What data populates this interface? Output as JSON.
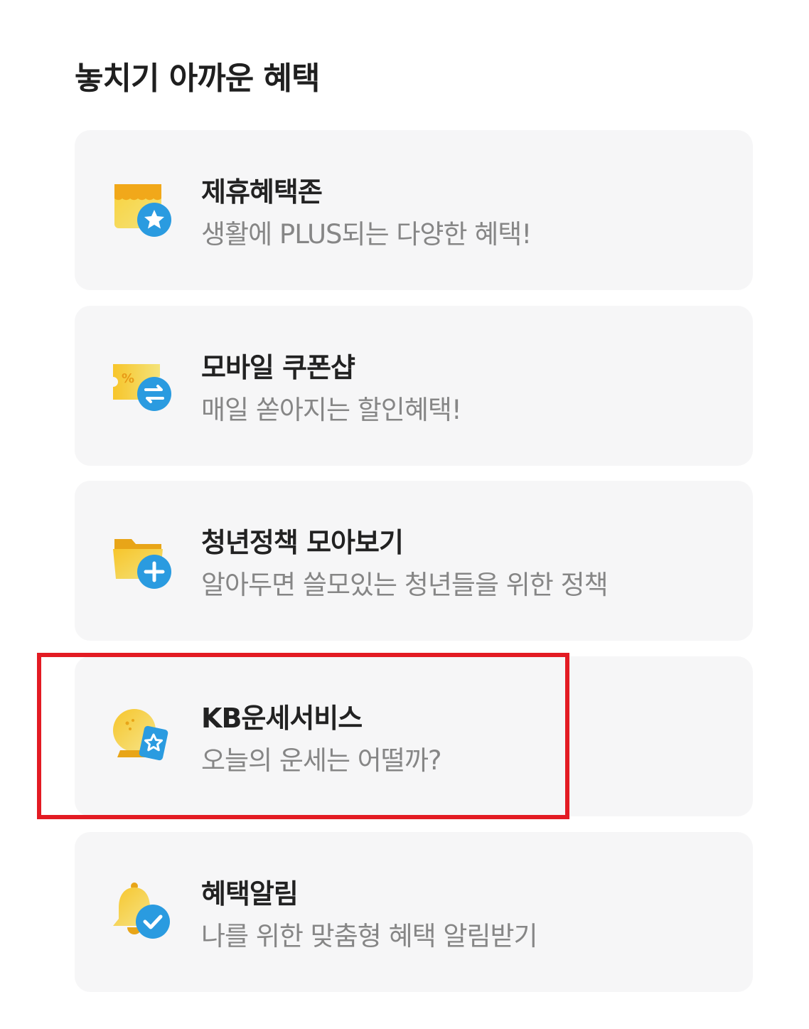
{
  "section": {
    "title": "놓치기 아까운 혜택"
  },
  "cards": [
    {
      "title": "제휴혜택존",
      "desc": "생활에 PLUS되는 다양한 혜택!",
      "icon": "store-star-icon"
    },
    {
      "title": "모바일 쿠폰샵",
      "desc": "매일 쏟아지는 할인혜택!",
      "icon": "coupon-exchange-icon"
    },
    {
      "title": "청년정책 모아보기",
      "desc": "알아두면 쓸모있는 청년들을 위한 정책",
      "icon": "folder-plus-icon"
    },
    {
      "title": "KB운세서비스",
      "desc": "오늘의 운세는 어떨까?",
      "icon": "crystal-ball-card-icon"
    },
    {
      "title": "혜택알림",
      "desc": "나를 위한 맞춤형 혜택 알림받기",
      "icon": "bell-check-icon"
    }
  ],
  "colors": {
    "card_background": "#f6f6f7",
    "title_text": "#222222",
    "desc_text": "#868686",
    "icon_yellow": "#f7c52b",
    "icon_blue": "#2a9be0",
    "highlight": "#e31b23"
  }
}
